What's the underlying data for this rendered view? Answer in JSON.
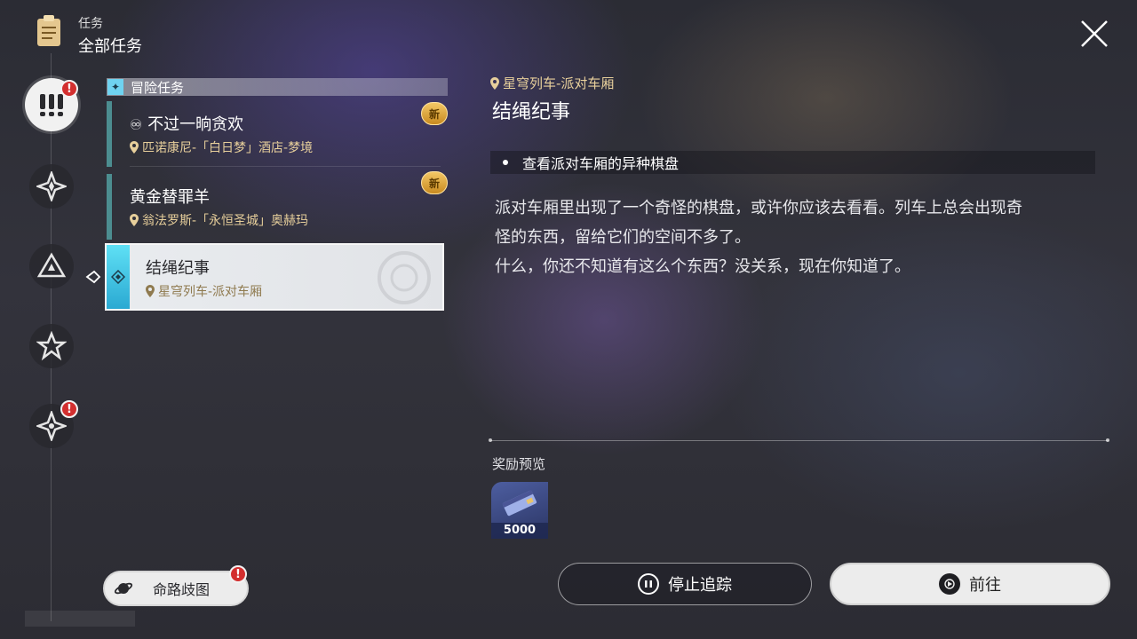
{
  "header": {
    "category": "任务",
    "title": "全部任务"
  },
  "section": {
    "label": "冒险任务"
  },
  "quests": [
    {
      "title": "不过一晌贪欢",
      "location": "匹诺康尼-「白日梦」酒店-梦境",
      "badge": "新"
    },
    {
      "title": "黄金替罪羊",
      "location": "翁法罗斯-「永恒圣城」奥赫玛",
      "badge": "新"
    },
    {
      "title": "结绳纪事",
      "location": "星穹列车-派对车厢"
    }
  ],
  "detail": {
    "location": "星穹列车-派对车厢",
    "title": "结绳纪事",
    "objective": "查看派对车厢的异种棋盘",
    "description_line1": "派对车厢里出现了一个奇怪的棋盘，或许你应该去看看。列车上总会出现奇",
    "description_line2": "怪的东西，留给它们的空间不多了。",
    "description_line3": "什么，你还不知道有这么个东西？没关系，现在你知道了。",
    "reward_label": "奖励预览",
    "reward_qty": "5000"
  },
  "buttons": {
    "path_map": "命路歧图",
    "stop_tracking": "停止追踪",
    "go": "前往"
  },
  "alerts": {
    "badge_symbol": "!"
  },
  "colors": {
    "accent_cyan": "#6fd3f0",
    "location_gold": "#e7cf9b",
    "alert_red": "#d32f2f",
    "quest_bar_teal": "#4c8d90"
  }
}
